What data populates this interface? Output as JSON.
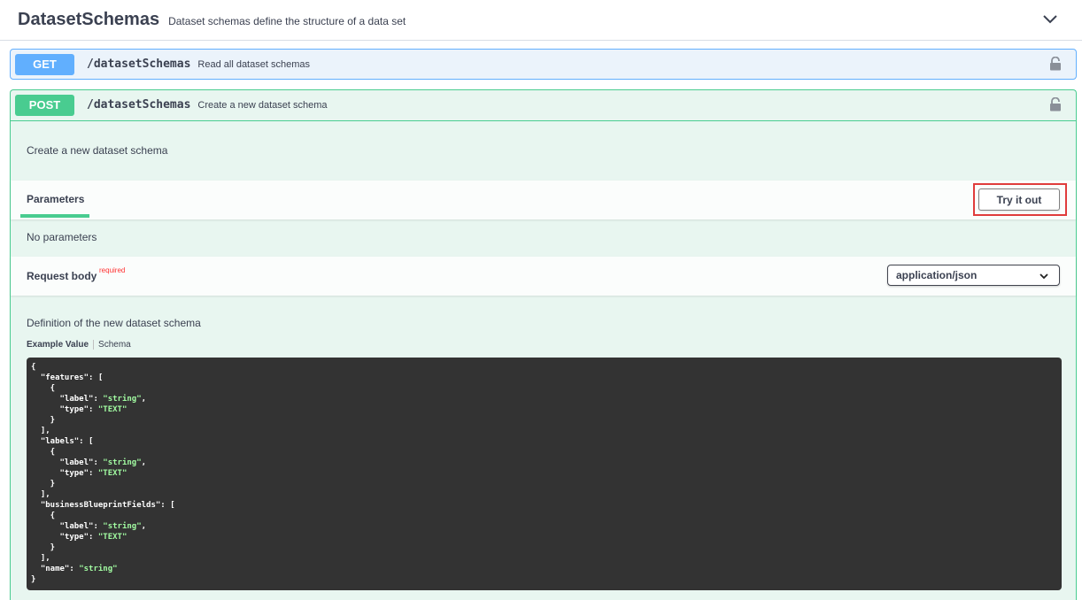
{
  "tag": {
    "title": "DatasetSchemas",
    "description": "Dataset schemas define the structure of a data set"
  },
  "get_op": {
    "method": "GET",
    "path": "/datasetSchemas",
    "summary": "Read all dataset schemas"
  },
  "post_op": {
    "method": "POST",
    "path": "/datasetSchemas",
    "summary": "Create a new dataset schema",
    "description": "Create a new dataset schema",
    "parameters_tab": "Parameters",
    "try_button": "Try it out",
    "no_params": "No parameters",
    "request_body_label": "Request body",
    "required_label": "required",
    "content_type": "application/json",
    "body_description": "Definition of the new dataset schema",
    "example_tab": "Example Value",
    "schema_tab": "Schema",
    "example_lines": [
      "{",
      "  \"features\": [",
      "    {",
      "      \"label\": \"string\",",
      "      \"type\": \"TEXT\"",
      "    }",
      "  ],",
      "  \"labels\": [",
      "    {",
      "      \"label\": \"string\",",
      "      \"type\": \"TEXT\"",
      "    }",
      "  ],",
      "  \"businessBlueprintFields\": [",
      "    {",
      "      \"label\": \"string\",",
      "      \"type\": \"TEXT\"",
      "    }",
      "  ],",
      "  \"name\": \"string\"",
      "}"
    ]
  },
  "colors": {
    "get": "#61affe",
    "post": "#49cc90",
    "highlight": "#e03c3c",
    "code_bg": "#333333",
    "code_string": "#a2fca2"
  }
}
